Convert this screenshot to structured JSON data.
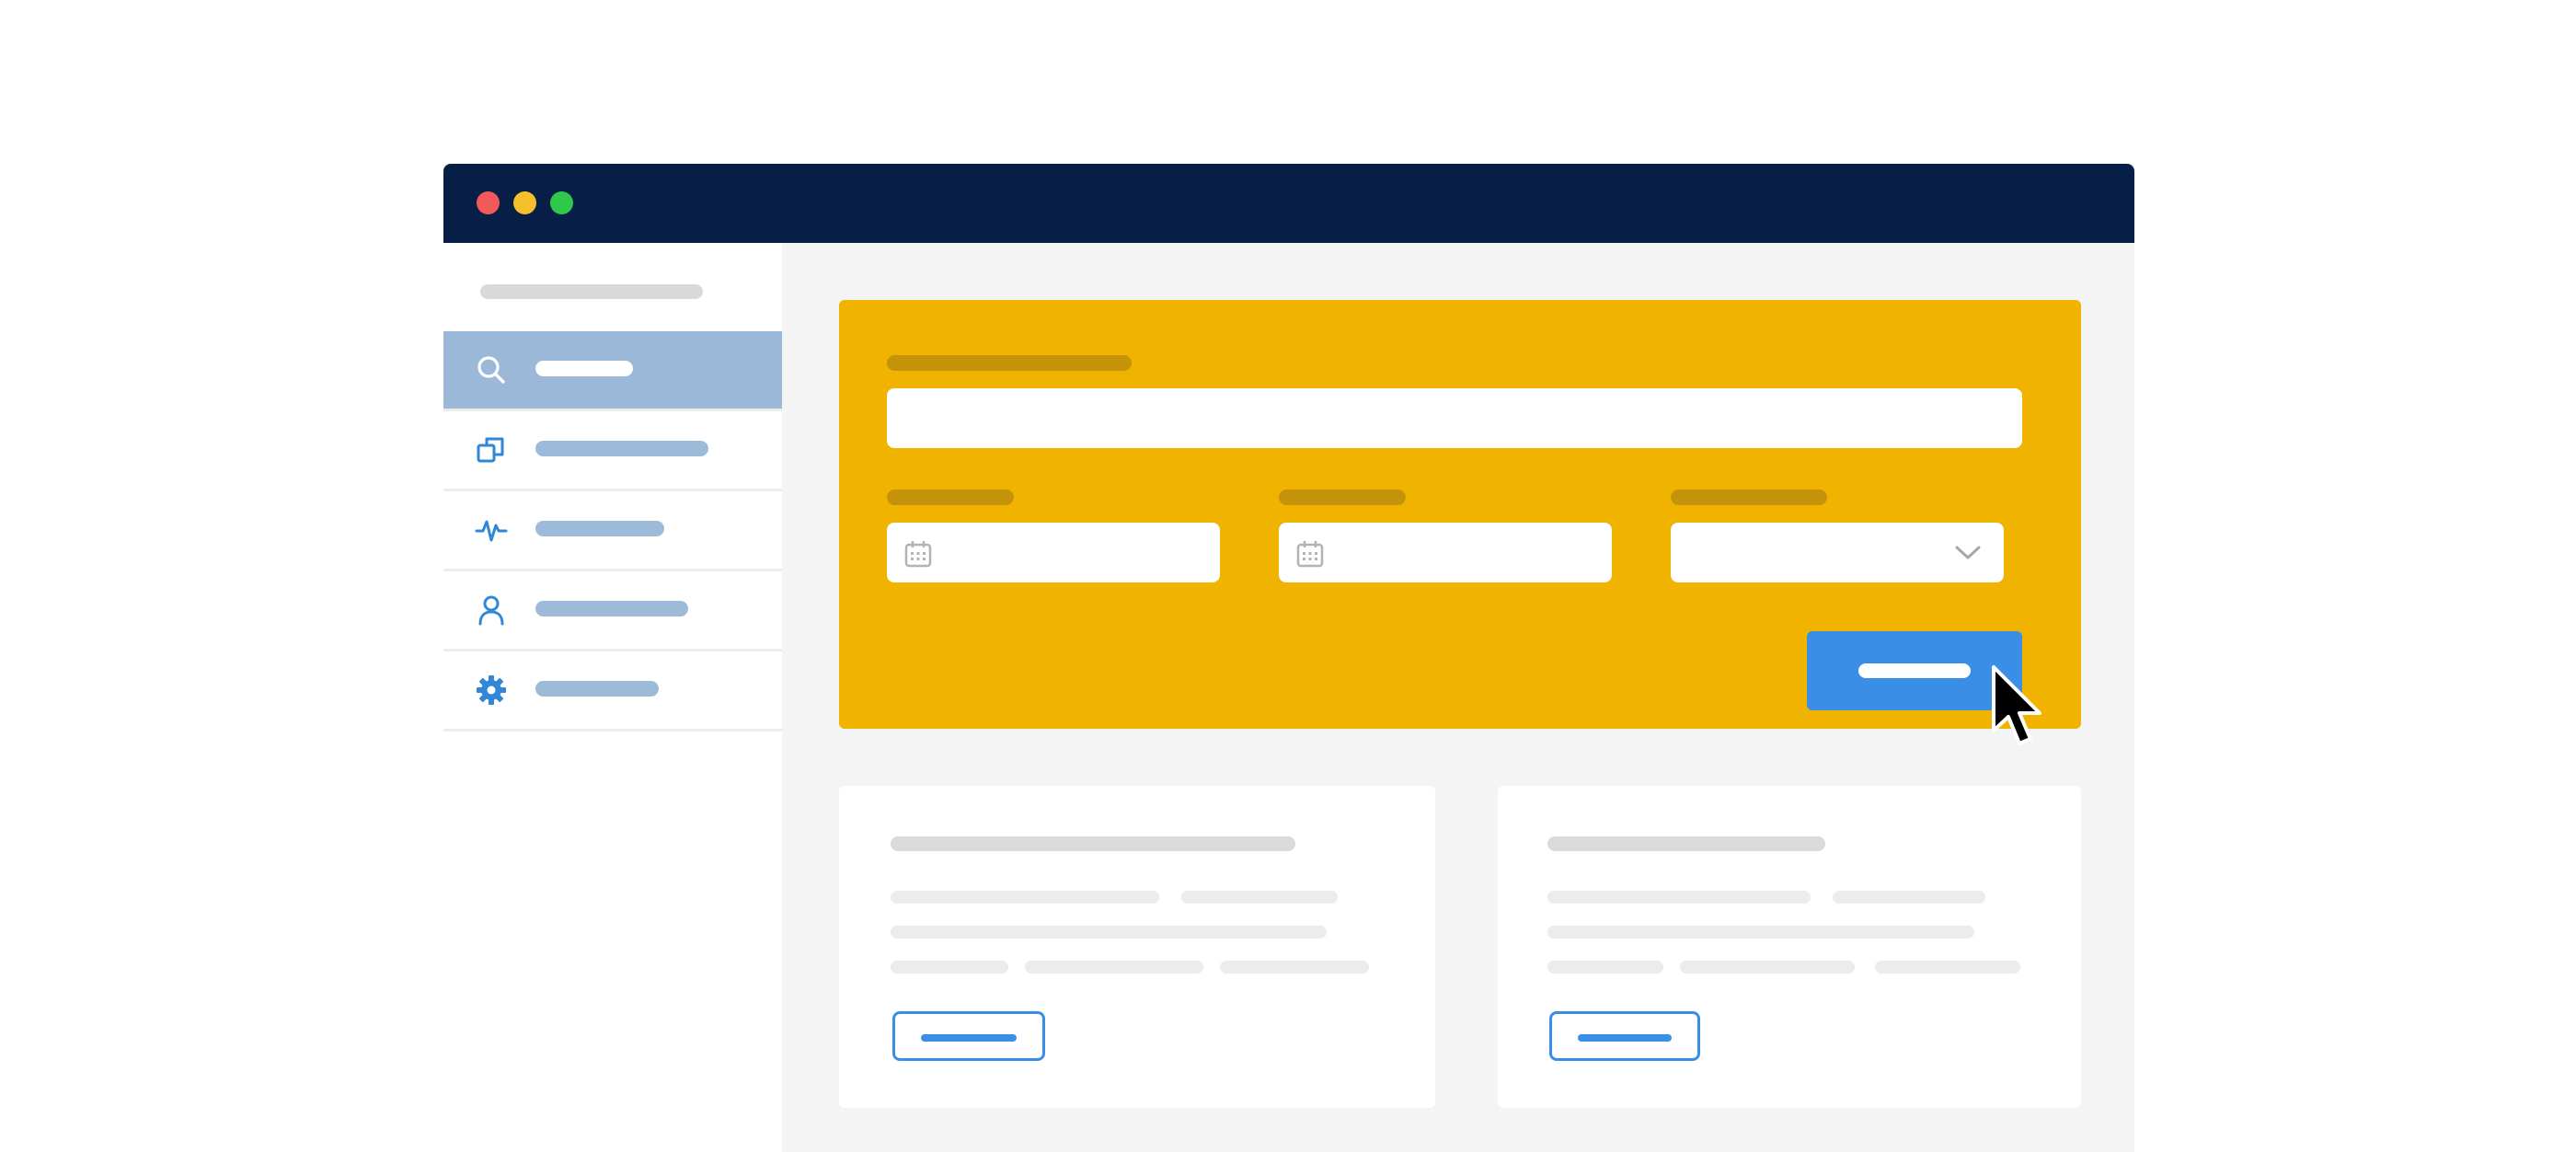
{
  "colors": {
    "titlebar_bg": "#071e47",
    "traffic_light_red": "#f25a5a",
    "traffic_light_yellow": "#f5c02b",
    "traffic_light_green": "#2fc84b",
    "sidebar_active_bg": "#9bb8d8",
    "icon_blue": "#2f87d6",
    "panel_bg": "#f0b400",
    "primary_button": "#3a8ee6"
  },
  "window": {
    "traffic_lights": [
      "close",
      "minimize",
      "maximize"
    ]
  },
  "sidebar": {
    "items": [
      {
        "icon": "search-icon",
        "label": "",
        "active": true
      },
      {
        "icon": "copy-icon",
        "label": "",
        "active": false
      },
      {
        "icon": "activity-icon",
        "label": "",
        "active": false
      },
      {
        "icon": "user-icon",
        "label": "",
        "active": false
      },
      {
        "icon": "gear-icon",
        "label": "",
        "active": false
      }
    ]
  },
  "search_panel": {
    "keyword": {
      "label": "",
      "value": "",
      "placeholder": ""
    },
    "start_date": {
      "label": "",
      "value": "",
      "icon": "calendar-icon"
    },
    "end_date": {
      "label": "",
      "value": "",
      "icon": "calendar-icon"
    },
    "select": {
      "label": "",
      "value": "",
      "icon": "chevron-down-icon"
    },
    "search_button_label": ""
  },
  "cards": [
    {
      "title": "",
      "button_label": ""
    },
    {
      "title": "",
      "button_label": ""
    }
  ],
  "cursor": {
    "icon": "mouse-pointer-icon"
  }
}
